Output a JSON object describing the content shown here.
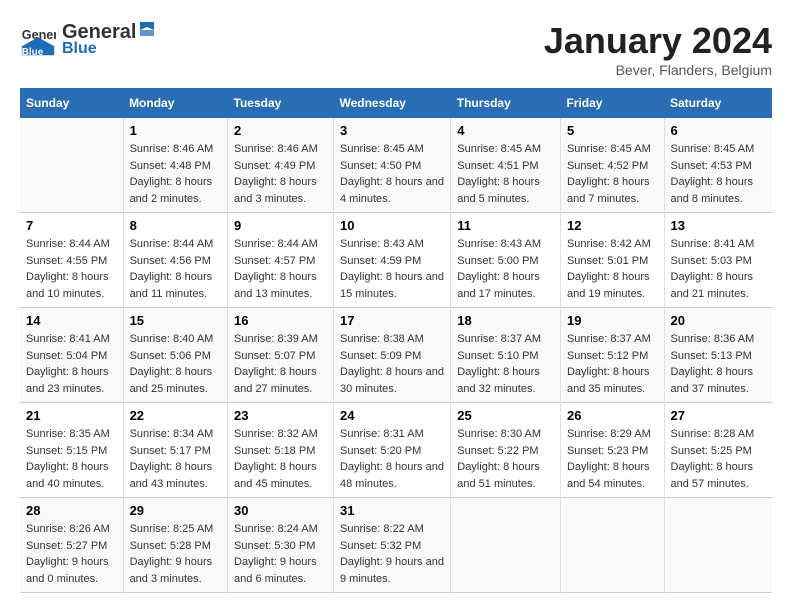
{
  "header": {
    "logo_general": "General",
    "logo_blue": "Blue",
    "title": "January 2024",
    "subtitle": "Bever, Flanders, Belgium"
  },
  "days_of_week": [
    "Sunday",
    "Monday",
    "Tuesday",
    "Wednesday",
    "Thursday",
    "Friday",
    "Saturday"
  ],
  "weeks": [
    [
      {
        "day": "",
        "sunrise": "",
        "sunset": "",
        "daylight": ""
      },
      {
        "day": "1",
        "sunrise": "Sunrise: 8:46 AM",
        "sunset": "Sunset: 4:48 PM",
        "daylight": "Daylight: 8 hours and 2 minutes."
      },
      {
        "day": "2",
        "sunrise": "Sunrise: 8:46 AM",
        "sunset": "Sunset: 4:49 PM",
        "daylight": "Daylight: 8 hours and 3 minutes."
      },
      {
        "day": "3",
        "sunrise": "Sunrise: 8:45 AM",
        "sunset": "Sunset: 4:50 PM",
        "daylight": "Daylight: 8 hours and 4 minutes."
      },
      {
        "day": "4",
        "sunrise": "Sunrise: 8:45 AM",
        "sunset": "Sunset: 4:51 PM",
        "daylight": "Daylight: 8 hours and 5 minutes."
      },
      {
        "day": "5",
        "sunrise": "Sunrise: 8:45 AM",
        "sunset": "Sunset: 4:52 PM",
        "daylight": "Daylight: 8 hours and 7 minutes."
      },
      {
        "day": "6",
        "sunrise": "Sunrise: 8:45 AM",
        "sunset": "Sunset: 4:53 PM",
        "daylight": "Daylight: 8 hours and 8 minutes."
      }
    ],
    [
      {
        "day": "7",
        "sunrise": "Sunrise: 8:44 AM",
        "sunset": "Sunset: 4:55 PM",
        "daylight": "Daylight: 8 hours and 10 minutes."
      },
      {
        "day": "8",
        "sunrise": "Sunrise: 8:44 AM",
        "sunset": "Sunset: 4:56 PM",
        "daylight": "Daylight: 8 hours and 11 minutes."
      },
      {
        "day": "9",
        "sunrise": "Sunrise: 8:44 AM",
        "sunset": "Sunset: 4:57 PM",
        "daylight": "Daylight: 8 hours and 13 minutes."
      },
      {
        "day": "10",
        "sunrise": "Sunrise: 8:43 AM",
        "sunset": "Sunset: 4:59 PM",
        "daylight": "Daylight: 8 hours and 15 minutes."
      },
      {
        "day": "11",
        "sunrise": "Sunrise: 8:43 AM",
        "sunset": "Sunset: 5:00 PM",
        "daylight": "Daylight: 8 hours and 17 minutes."
      },
      {
        "day": "12",
        "sunrise": "Sunrise: 8:42 AM",
        "sunset": "Sunset: 5:01 PM",
        "daylight": "Daylight: 8 hours and 19 minutes."
      },
      {
        "day": "13",
        "sunrise": "Sunrise: 8:41 AM",
        "sunset": "Sunset: 5:03 PM",
        "daylight": "Daylight: 8 hours and 21 minutes."
      }
    ],
    [
      {
        "day": "14",
        "sunrise": "Sunrise: 8:41 AM",
        "sunset": "Sunset: 5:04 PM",
        "daylight": "Daylight: 8 hours and 23 minutes."
      },
      {
        "day": "15",
        "sunrise": "Sunrise: 8:40 AM",
        "sunset": "Sunset: 5:06 PM",
        "daylight": "Daylight: 8 hours and 25 minutes."
      },
      {
        "day": "16",
        "sunrise": "Sunrise: 8:39 AM",
        "sunset": "Sunset: 5:07 PM",
        "daylight": "Daylight: 8 hours and 27 minutes."
      },
      {
        "day": "17",
        "sunrise": "Sunrise: 8:38 AM",
        "sunset": "Sunset: 5:09 PM",
        "daylight": "Daylight: 8 hours and 30 minutes."
      },
      {
        "day": "18",
        "sunrise": "Sunrise: 8:37 AM",
        "sunset": "Sunset: 5:10 PM",
        "daylight": "Daylight: 8 hours and 32 minutes."
      },
      {
        "day": "19",
        "sunrise": "Sunrise: 8:37 AM",
        "sunset": "Sunset: 5:12 PM",
        "daylight": "Daylight: 8 hours and 35 minutes."
      },
      {
        "day": "20",
        "sunrise": "Sunrise: 8:36 AM",
        "sunset": "Sunset: 5:13 PM",
        "daylight": "Daylight: 8 hours and 37 minutes."
      }
    ],
    [
      {
        "day": "21",
        "sunrise": "Sunrise: 8:35 AM",
        "sunset": "Sunset: 5:15 PM",
        "daylight": "Daylight: 8 hours and 40 minutes."
      },
      {
        "day": "22",
        "sunrise": "Sunrise: 8:34 AM",
        "sunset": "Sunset: 5:17 PM",
        "daylight": "Daylight: 8 hours and 43 minutes."
      },
      {
        "day": "23",
        "sunrise": "Sunrise: 8:32 AM",
        "sunset": "Sunset: 5:18 PM",
        "daylight": "Daylight: 8 hours and 45 minutes."
      },
      {
        "day": "24",
        "sunrise": "Sunrise: 8:31 AM",
        "sunset": "Sunset: 5:20 PM",
        "daylight": "Daylight: 8 hours and 48 minutes."
      },
      {
        "day": "25",
        "sunrise": "Sunrise: 8:30 AM",
        "sunset": "Sunset: 5:22 PM",
        "daylight": "Daylight: 8 hours and 51 minutes."
      },
      {
        "day": "26",
        "sunrise": "Sunrise: 8:29 AM",
        "sunset": "Sunset: 5:23 PM",
        "daylight": "Daylight: 8 hours and 54 minutes."
      },
      {
        "day": "27",
        "sunrise": "Sunrise: 8:28 AM",
        "sunset": "Sunset: 5:25 PM",
        "daylight": "Daylight: 8 hours and 57 minutes."
      }
    ],
    [
      {
        "day": "28",
        "sunrise": "Sunrise: 8:26 AM",
        "sunset": "Sunset: 5:27 PM",
        "daylight": "Daylight: 9 hours and 0 minutes."
      },
      {
        "day": "29",
        "sunrise": "Sunrise: 8:25 AM",
        "sunset": "Sunset: 5:28 PM",
        "daylight": "Daylight: 9 hours and 3 minutes."
      },
      {
        "day": "30",
        "sunrise": "Sunrise: 8:24 AM",
        "sunset": "Sunset: 5:30 PM",
        "daylight": "Daylight: 9 hours and 6 minutes."
      },
      {
        "day": "31",
        "sunrise": "Sunrise: 8:22 AM",
        "sunset": "Sunset: 5:32 PM",
        "daylight": "Daylight: 9 hours and 9 minutes."
      },
      {
        "day": "",
        "sunrise": "",
        "sunset": "",
        "daylight": ""
      },
      {
        "day": "",
        "sunrise": "",
        "sunset": "",
        "daylight": ""
      },
      {
        "day": "",
        "sunrise": "",
        "sunset": "",
        "daylight": ""
      }
    ]
  ]
}
